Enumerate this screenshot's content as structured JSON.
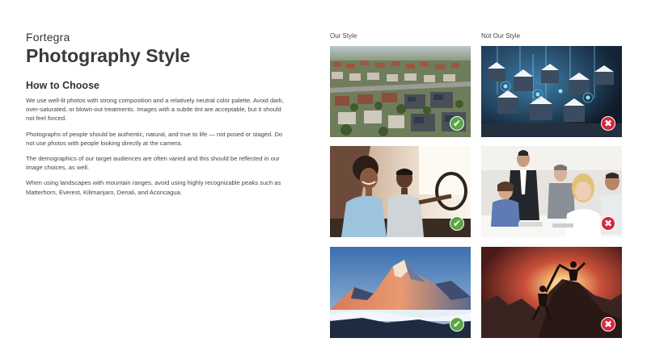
{
  "brand": "Fortegra",
  "title": "Photography Style",
  "heading": "How to Choose",
  "paragraphs": [
    "We use well-lit photos with strong composition and a relatively neutral color palette. Avoid dark, over-saturated, or blown-out treatments. Images with a subtle tint are acceptable, but it should not feel forced.",
    "Photographs of people should be authentic, natural, and true to life — not posed or staged. Do not use photos with people looking directly at the camera.",
    "The demographics of our target audiences are often varied and this should be reflected in our image choices, as well.",
    "When using landscapes with mountain ranges, avoid using highly recognizable peaks such as Matterhorn, Everest, Kilimanjaro, Denali, and Aconcagua."
  ],
  "columns": {
    "good_label": "Our Style",
    "bad_label": "Not Our Style"
  },
  "photos": [
    {
      "subject": "suburban-houses-aerial",
      "style": "good",
      "badge": "✔"
    },
    {
      "subject": "tech-overlay-houses",
      "style": "bad",
      "badge": "✖"
    },
    {
      "subject": "people-in-car",
      "style": "good",
      "badge": "✔"
    },
    {
      "subject": "office-team-posed",
      "style": "bad",
      "badge": "✖"
    },
    {
      "subject": "mountain-peak-sunrise",
      "style": "good",
      "badge": "✔"
    },
    {
      "subject": "climbers-silhouette",
      "style": "bad",
      "badge": "✖"
    }
  ],
  "colors": {
    "good": "#5aa646",
    "bad": "#d9253b"
  },
  "icons": {
    "good": "checkmark-icon",
    "bad": "x-mark-icon"
  }
}
